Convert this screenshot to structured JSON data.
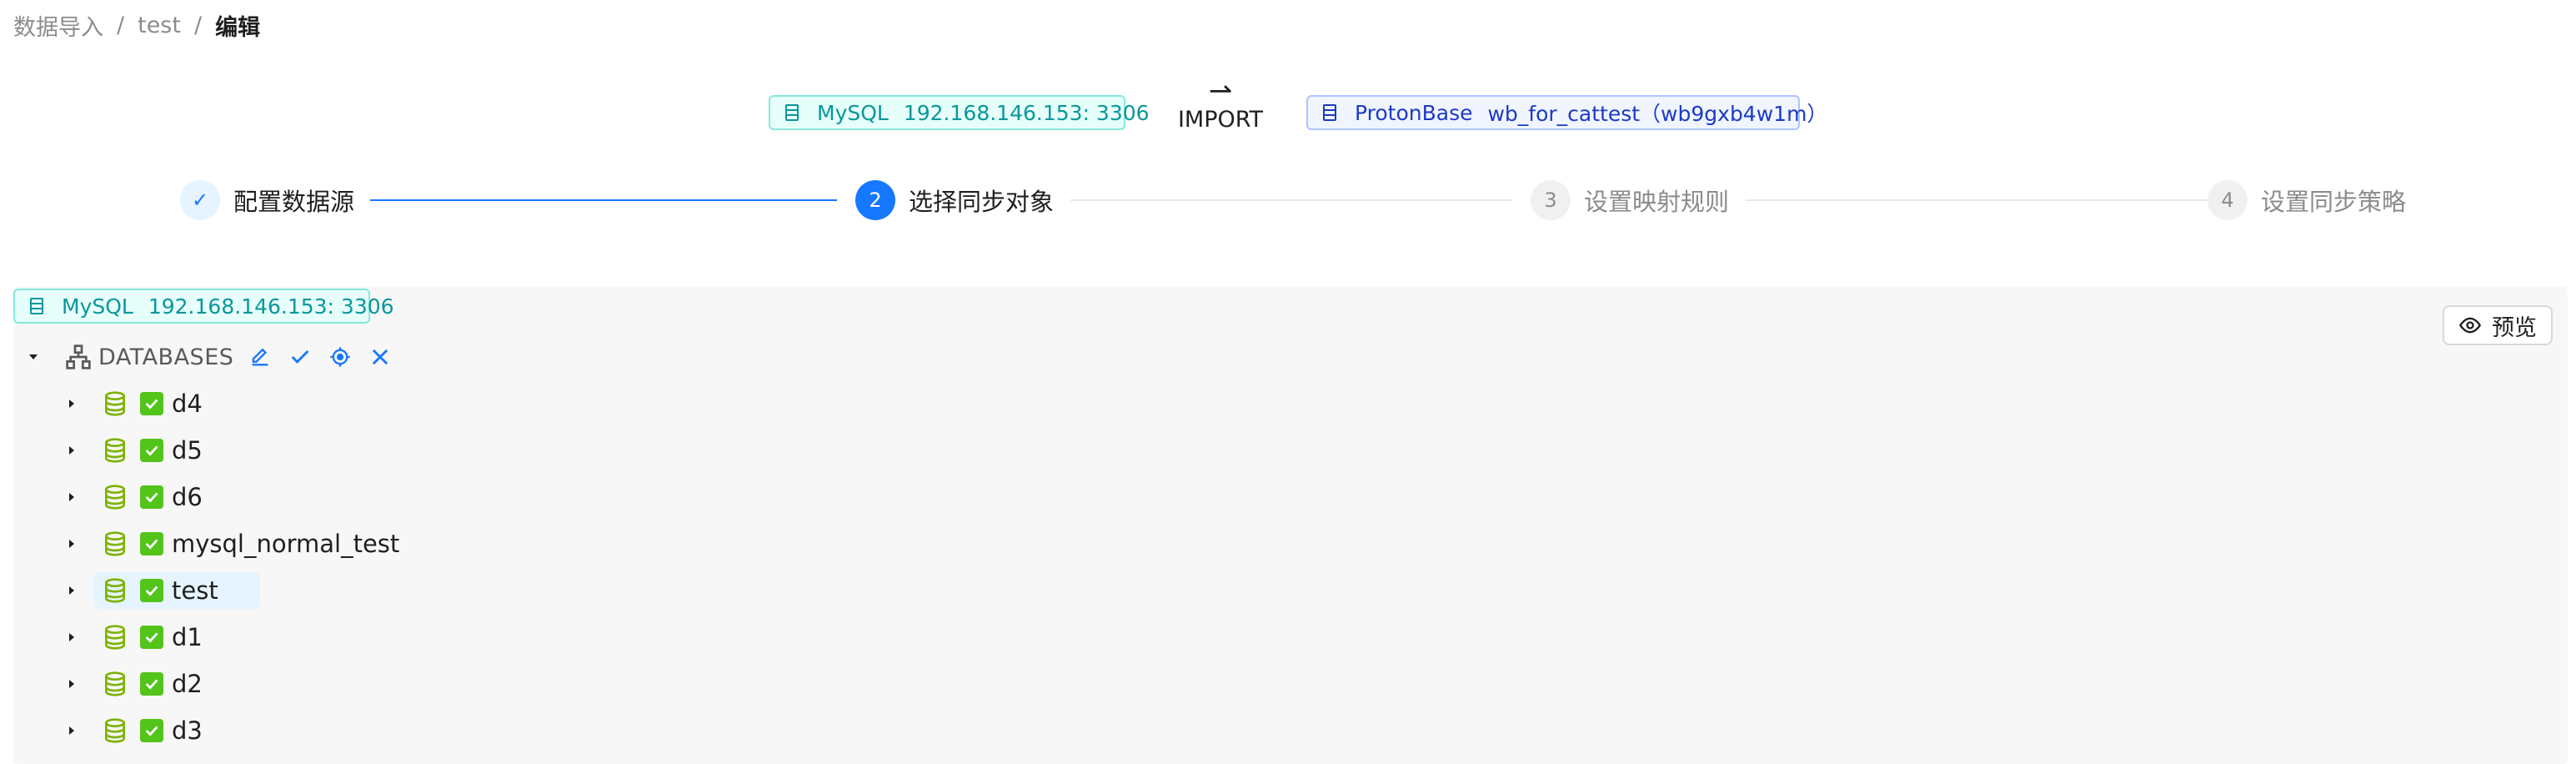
{
  "breadcrumb": {
    "items": [
      "数据导入",
      "test"
    ],
    "separator": "/",
    "current": "编辑"
  },
  "header": {
    "source": {
      "type": "MySQL",
      "address": "192.168.146.153: 3306",
      "icon": "database-server-icon"
    },
    "arrow": "⇀",
    "action": "IMPORT",
    "target": {
      "type": "ProtonBase",
      "name": "wb_for_cattest（wb9gxb4w1m）",
      "icon": "database-server-icon"
    }
  },
  "steps": [
    {
      "marker": "✓",
      "title": "配置数据源",
      "status": "done"
    },
    {
      "marker": "2",
      "title": "选择同步对象",
      "status": "active"
    },
    {
      "marker": "3",
      "title": "设置映射规则",
      "status": "wait"
    },
    {
      "marker": "4",
      "title": "设置同步策略",
      "status": "wait"
    }
  ],
  "panel": {
    "source": {
      "type": "MySQL",
      "address": "192.168.146.153: 3306"
    },
    "preview_label": "预览",
    "tree": {
      "root_label": "DATABASES",
      "root_actions": [
        "edit-icon",
        "check-icon",
        "locate-icon",
        "close-icon"
      ],
      "nodes": [
        {
          "label": "d4",
          "checked": true
        },
        {
          "label": "d5",
          "checked": true
        },
        {
          "label": "d6",
          "checked": true
        },
        {
          "label": "mysql_normal_test",
          "checked": true
        },
        {
          "label": "test",
          "checked": true,
          "selected": true
        },
        {
          "label": "d1",
          "checked": true
        },
        {
          "label": "d2",
          "checked": true
        },
        {
          "label": "d3",
          "checked": true
        }
      ]
    }
  },
  "colors": {
    "primary": "#1677ff",
    "source_tag": "#08979c",
    "target_tag": "#1d39c4",
    "check": "#52c41a",
    "db_icon": "#7cb305"
  }
}
